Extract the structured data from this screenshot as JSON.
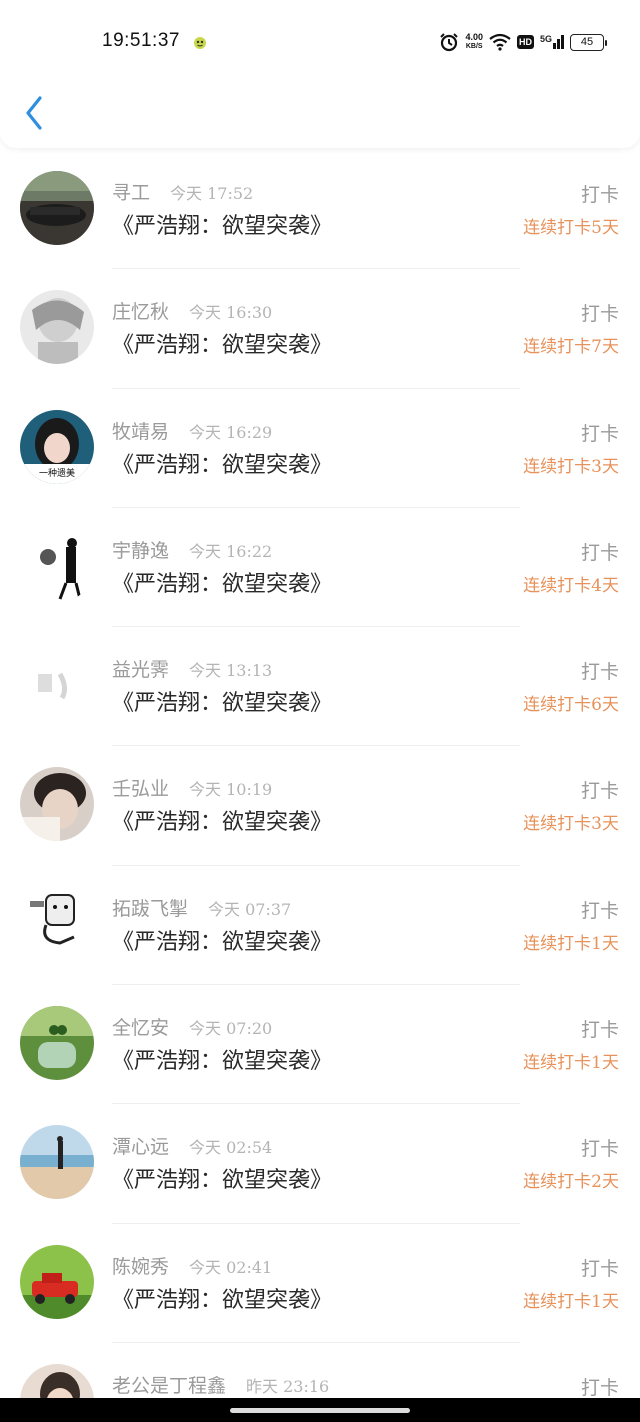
{
  "status": {
    "time": "19:51:37",
    "net_speed_value": "4.00",
    "net_speed_unit": "KB/S",
    "hd": "HD",
    "signal": "5G",
    "battery": "45"
  },
  "header": {
    "back_icon": "chevron-left-icon"
  },
  "rows": [
    {
      "name": "寻工",
      "time": "今天 17:52",
      "book": "《严浩翔：欲望突袭》",
      "checkin": "打卡",
      "streak": "连续打卡5天"
    },
    {
      "name": "庄忆秋",
      "time": "今天 16:30",
      "book": "《严浩翔：欲望突袭》",
      "checkin": "打卡",
      "streak": "连续打卡7天"
    },
    {
      "name": "牧靖易",
      "time": "今天 16:29",
      "book": "《严浩翔：欲望突袭》",
      "checkin": "打卡",
      "streak": "连续打卡3天"
    },
    {
      "name": "宇静逸",
      "time": "今天 16:22",
      "book": "《严浩翔：欲望突袭》",
      "checkin": "打卡",
      "streak": "连续打卡4天"
    },
    {
      "name": "益光霁",
      "time": "今天 13:13",
      "book": "《严浩翔：欲望突袭》",
      "checkin": "打卡",
      "streak": "连续打卡6天"
    },
    {
      "name": "壬弘业",
      "time": "今天 10:19",
      "book": "《严浩翔：欲望突袭》",
      "checkin": "打卡",
      "streak": "连续打卡3天"
    },
    {
      "name": "拓跋飞掣",
      "time": "今天 07:37",
      "book": "《严浩翔：欲望突袭》",
      "checkin": "打卡",
      "streak": "连续打卡1天"
    },
    {
      "name": "全忆安",
      "time": "今天 07:20",
      "book": "《严浩翔：欲望突袭》",
      "checkin": "打卡",
      "streak": "连续打卡1天"
    },
    {
      "name": "潭心远",
      "time": "今天 02:54",
      "book": "《严浩翔：欲望突袭》",
      "checkin": "打卡",
      "streak": "连续打卡2天"
    },
    {
      "name": "陈婉秀",
      "time": "今天 02:41",
      "book": "《严浩翔：欲望突袭》",
      "checkin": "打卡",
      "streak": "连续打卡1天"
    },
    {
      "name": "老公是丁程鑫",
      "time": "昨天 23:16",
      "book": "",
      "checkin": "打卡",
      "streak": ""
    }
  ]
}
